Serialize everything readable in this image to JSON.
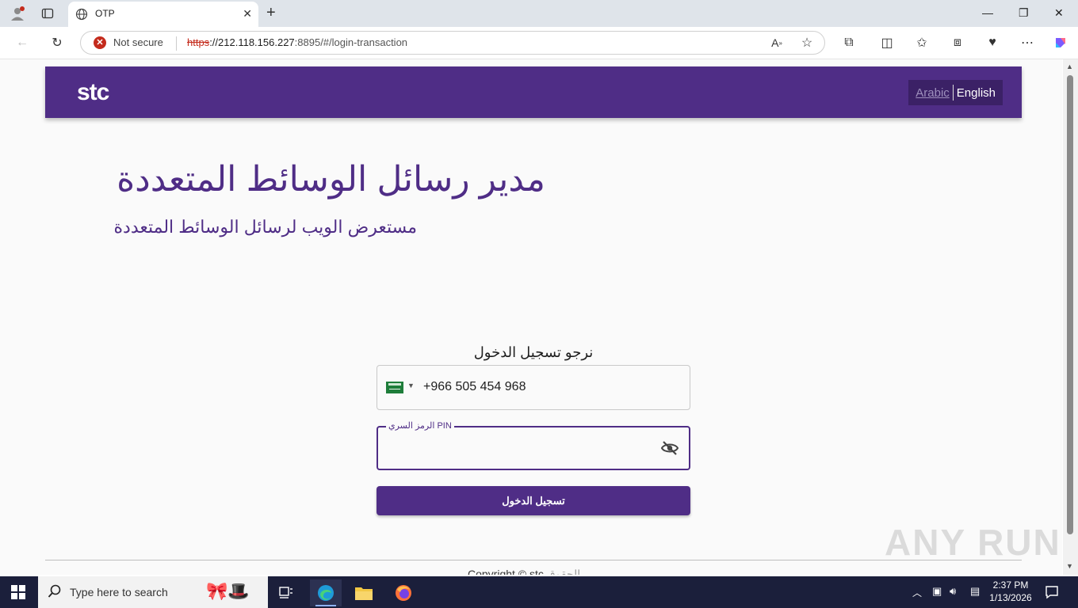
{
  "browser": {
    "tab_title": "OTP",
    "not_secure": "Not secure",
    "url_scheme": "https",
    "url_host": "://212.118.156.227",
    "url_rest": ":8895/#/login-transaction"
  },
  "page": {
    "logo": "stc",
    "lang_arabic": "Arabic",
    "lang_english": "English",
    "hero_title": "مدير رسائل الوسائط المتعددة",
    "hero_subtitle": "مستعرض الويب لرسائل الوسائط المتعددة",
    "login_heading": "نرجو تسجيل الدخول",
    "phone_value": "+966 505 454 968",
    "pin_label": "الرمز السري PIN",
    "login_button": "تسجيل الدخول",
    "copyright": "Copyright © stc",
    "copyright_ar": " الحقوق"
  },
  "taskbar": {
    "search_placeholder": "Type here to search",
    "time": "2:37 PM",
    "date": "1/13/2026"
  },
  "watermark": "ANY RUN",
  "colors": {
    "brand_purple": "#4f2d86",
    "warning_red": "#c42b1c",
    "taskbar": "#1b1f3b"
  }
}
